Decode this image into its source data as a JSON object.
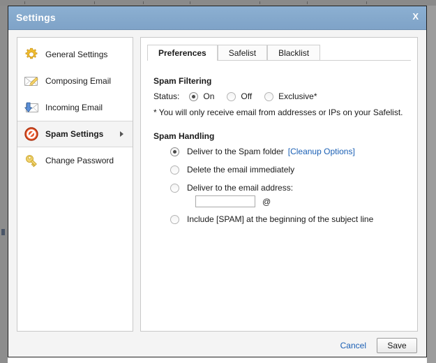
{
  "window": {
    "title": "Settings",
    "close_label": "X"
  },
  "sidebar": {
    "items": [
      {
        "label": "General Settings",
        "icon": "gear-icon",
        "active": false,
        "arrow": false
      },
      {
        "label": "Composing Email",
        "icon": "envelope-pencil-icon",
        "active": false,
        "arrow": false
      },
      {
        "label": "Incoming Email",
        "icon": "envelope-download-icon",
        "active": false,
        "arrow": false
      },
      {
        "label": "Spam Settings",
        "icon": "no-entry-icon",
        "active": true,
        "arrow": true
      },
      {
        "label": "Change Password",
        "icon": "key-icon",
        "active": false,
        "arrow": false
      }
    ]
  },
  "tabs": [
    {
      "label": "Preferences",
      "active": true
    },
    {
      "label": "Safelist",
      "active": false
    },
    {
      "label": "Blacklist",
      "active": false
    }
  ],
  "spam_filtering": {
    "title": "Spam Filtering",
    "status_label": "Status:",
    "options": [
      {
        "label": "On",
        "checked": true
      },
      {
        "label": "Off",
        "checked": false
      },
      {
        "label": "Exclusive*",
        "checked": false
      }
    ],
    "note": "* You will only receive email from addresses or IPs on your Safelist."
  },
  "spam_handling": {
    "title": "Spam Handling",
    "options": [
      {
        "label": "Deliver to the Spam folder",
        "checked": true,
        "link": "[Cleanup Options]"
      },
      {
        "label": "Delete the email immediately",
        "checked": false,
        "link": ""
      },
      {
        "label": "Deliver to the email address:",
        "checked": false,
        "link": ""
      },
      {
        "label": "Include [SPAM] at the beginning of the subject line",
        "checked": false,
        "link": ""
      }
    ],
    "email_input_value": "",
    "email_input_placeholder": "",
    "at_sign": "@"
  },
  "footer": {
    "cancel_label": "Cancel",
    "save_label": "Save"
  },
  "colors": {
    "titlebar": "#85a9cc",
    "link": "#1a5fb4",
    "spam_icon": "#e0542a",
    "gear_icon": "#f3c03a",
    "key_icon": "#f0cf66"
  }
}
